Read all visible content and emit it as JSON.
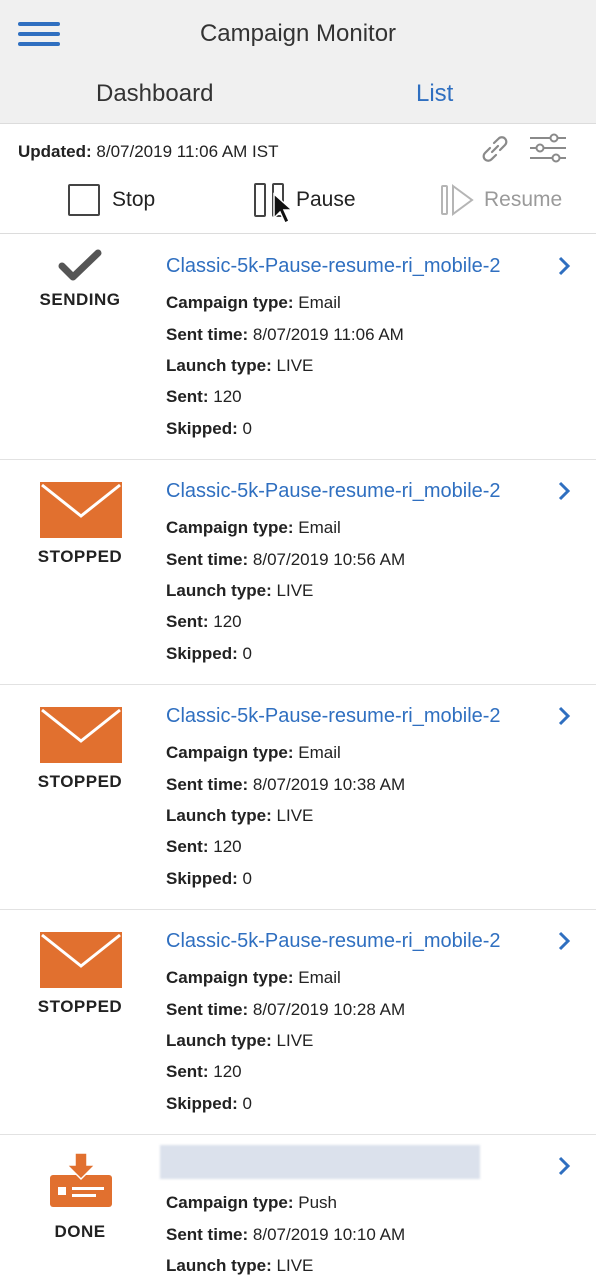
{
  "app": {
    "title": "Campaign Monitor",
    "tabs": {
      "dashboard": "Dashboard",
      "list": "List"
    }
  },
  "toolbar": {
    "updated_label": "Updated:",
    "updated_value": "8/07/2019 11:06 AM IST",
    "stop_label": "Stop",
    "pause_label": "Pause",
    "resume_label": "Resume"
  },
  "labels": {
    "campaign_type": "Campaign type:",
    "sent_time": "Sent time:",
    "launch_type": "Launch type:",
    "sent": "Sent:",
    "skipped": "Skipped:"
  },
  "colors": {
    "accent": "#2f6fc0",
    "envelope": "#e1702f",
    "muted": "#9a9a9a"
  },
  "campaigns": [
    {
      "status": "SENDING",
      "icon": "check-icon",
      "title": "Classic-5k-Pause-resume-ri_mobile-2",
      "campaign_type": "Email",
      "sent_time": "8/07/2019 11:06 AM",
      "launch_type": "LIVE",
      "sent": "120",
      "skipped": "0"
    },
    {
      "status": "STOPPED",
      "icon": "envelope-icon",
      "title": "Classic-5k-Pause-resume-ri_mobile-2",
      "campaign_type": "Email",
      "sent_time": "8/07/2019 10:56 AM",
      "launch_type": "LIVE",
      "sent": "120",
      "skipped": "0"
    },
    {
      "status": "STOPPED",
      "icon": "envelope-icon",
      "title": "Classic-5k-Pause-resume-ri_mobile-2",
      "campaign_type": "Email",
      "sent_time": "8/07/2019 10:38 AM",
      "launch_type": "LIVE",
      "sent": "120",
      "skipped": "0"
    },
    {
      "status": "STOPPED",
      "icon": "envelope-icon",
      "title": "Classic-5k-Pause-resume-ri_mobile-2",
      "campaign_type": "Email",
      "sent_time": "8/07/2019 10:28 AM",
      "launch_type": "LIVE",
      "sent": "120",
      "skipped": "0"
    },
    {
      "status": "DONE",
      "icon": "push-download-icon",
      "title": "",
      "campaign_type": "Push",
      "sent_time": "8/07/2019 10:10 AM",
      "launch_type": "LIVE"
    }
  ]
}
